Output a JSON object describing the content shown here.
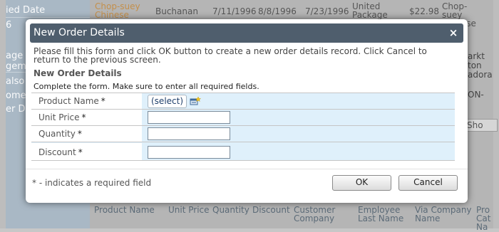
{
  "background": {
    "left_panel": {
      "items": [
        "ied Date",
        "6",
        "age a",
        "geme",
        "also",
        "ome",
        "er De"
      ]
    },
    "top_row": {
      "product": "Chop-suey Chinese",
      "employee": "Buchanan",
      "order_date": "7/11/1996",
      "required_date": "8/8/1996",
      "shipped_date": "7/23/1996",
      "ship_via": "United Package",
      "price": "$22.98",
      "product2": "Chop-suey Chinese"
    },
    "right_column": [
      "arkt",
      "ton",
      "adora",
      "ON-",
      "Sho"
    ],
    "show_button": "Sho",
    "grid_headers": [
      "Product Name",
      "Unit Price",
      "Quantity",
      "Discount",
      "Customer Company",
      "Employee Last Name",
      "Via Company Name",
      "Pro Cat Na"
    ]
  },
  "dialog": {
    "title": "New Order Details",
    "close_symbol": "×",
    "intro": "Please fill this form and click OK button to create a new order details record. Click Cancel to return to the previous screen.",
    "section_title": "New Order Details",
    "hint": "Complete the form. Make sure to enter all required fields.",
    "fields": {
      "product_name": {
        "label": "Product Name",
        "required": "*",
        "select_label": "(select)"
      },
      "unit_price": {
        "label": "Unit Price",
        "required": "*",
        "value": ""
      },
      "quantity": {
        "label": "Quantity",
        "required": "*",
        "value": ""
      },
      "discount": {
        "label": "Discount",
        "required": "*",
        "value": ""
      }
    },
    "required_note": "* - indicates a required field",
    "ok_label": "OK",
    "cancel_label": "Cancel"
  },
  "colors": {
    "titlebar": "#4f5e6d",
    "form_background": "#dff0fb",
    "link": "#1f3f6b"
  }
}
